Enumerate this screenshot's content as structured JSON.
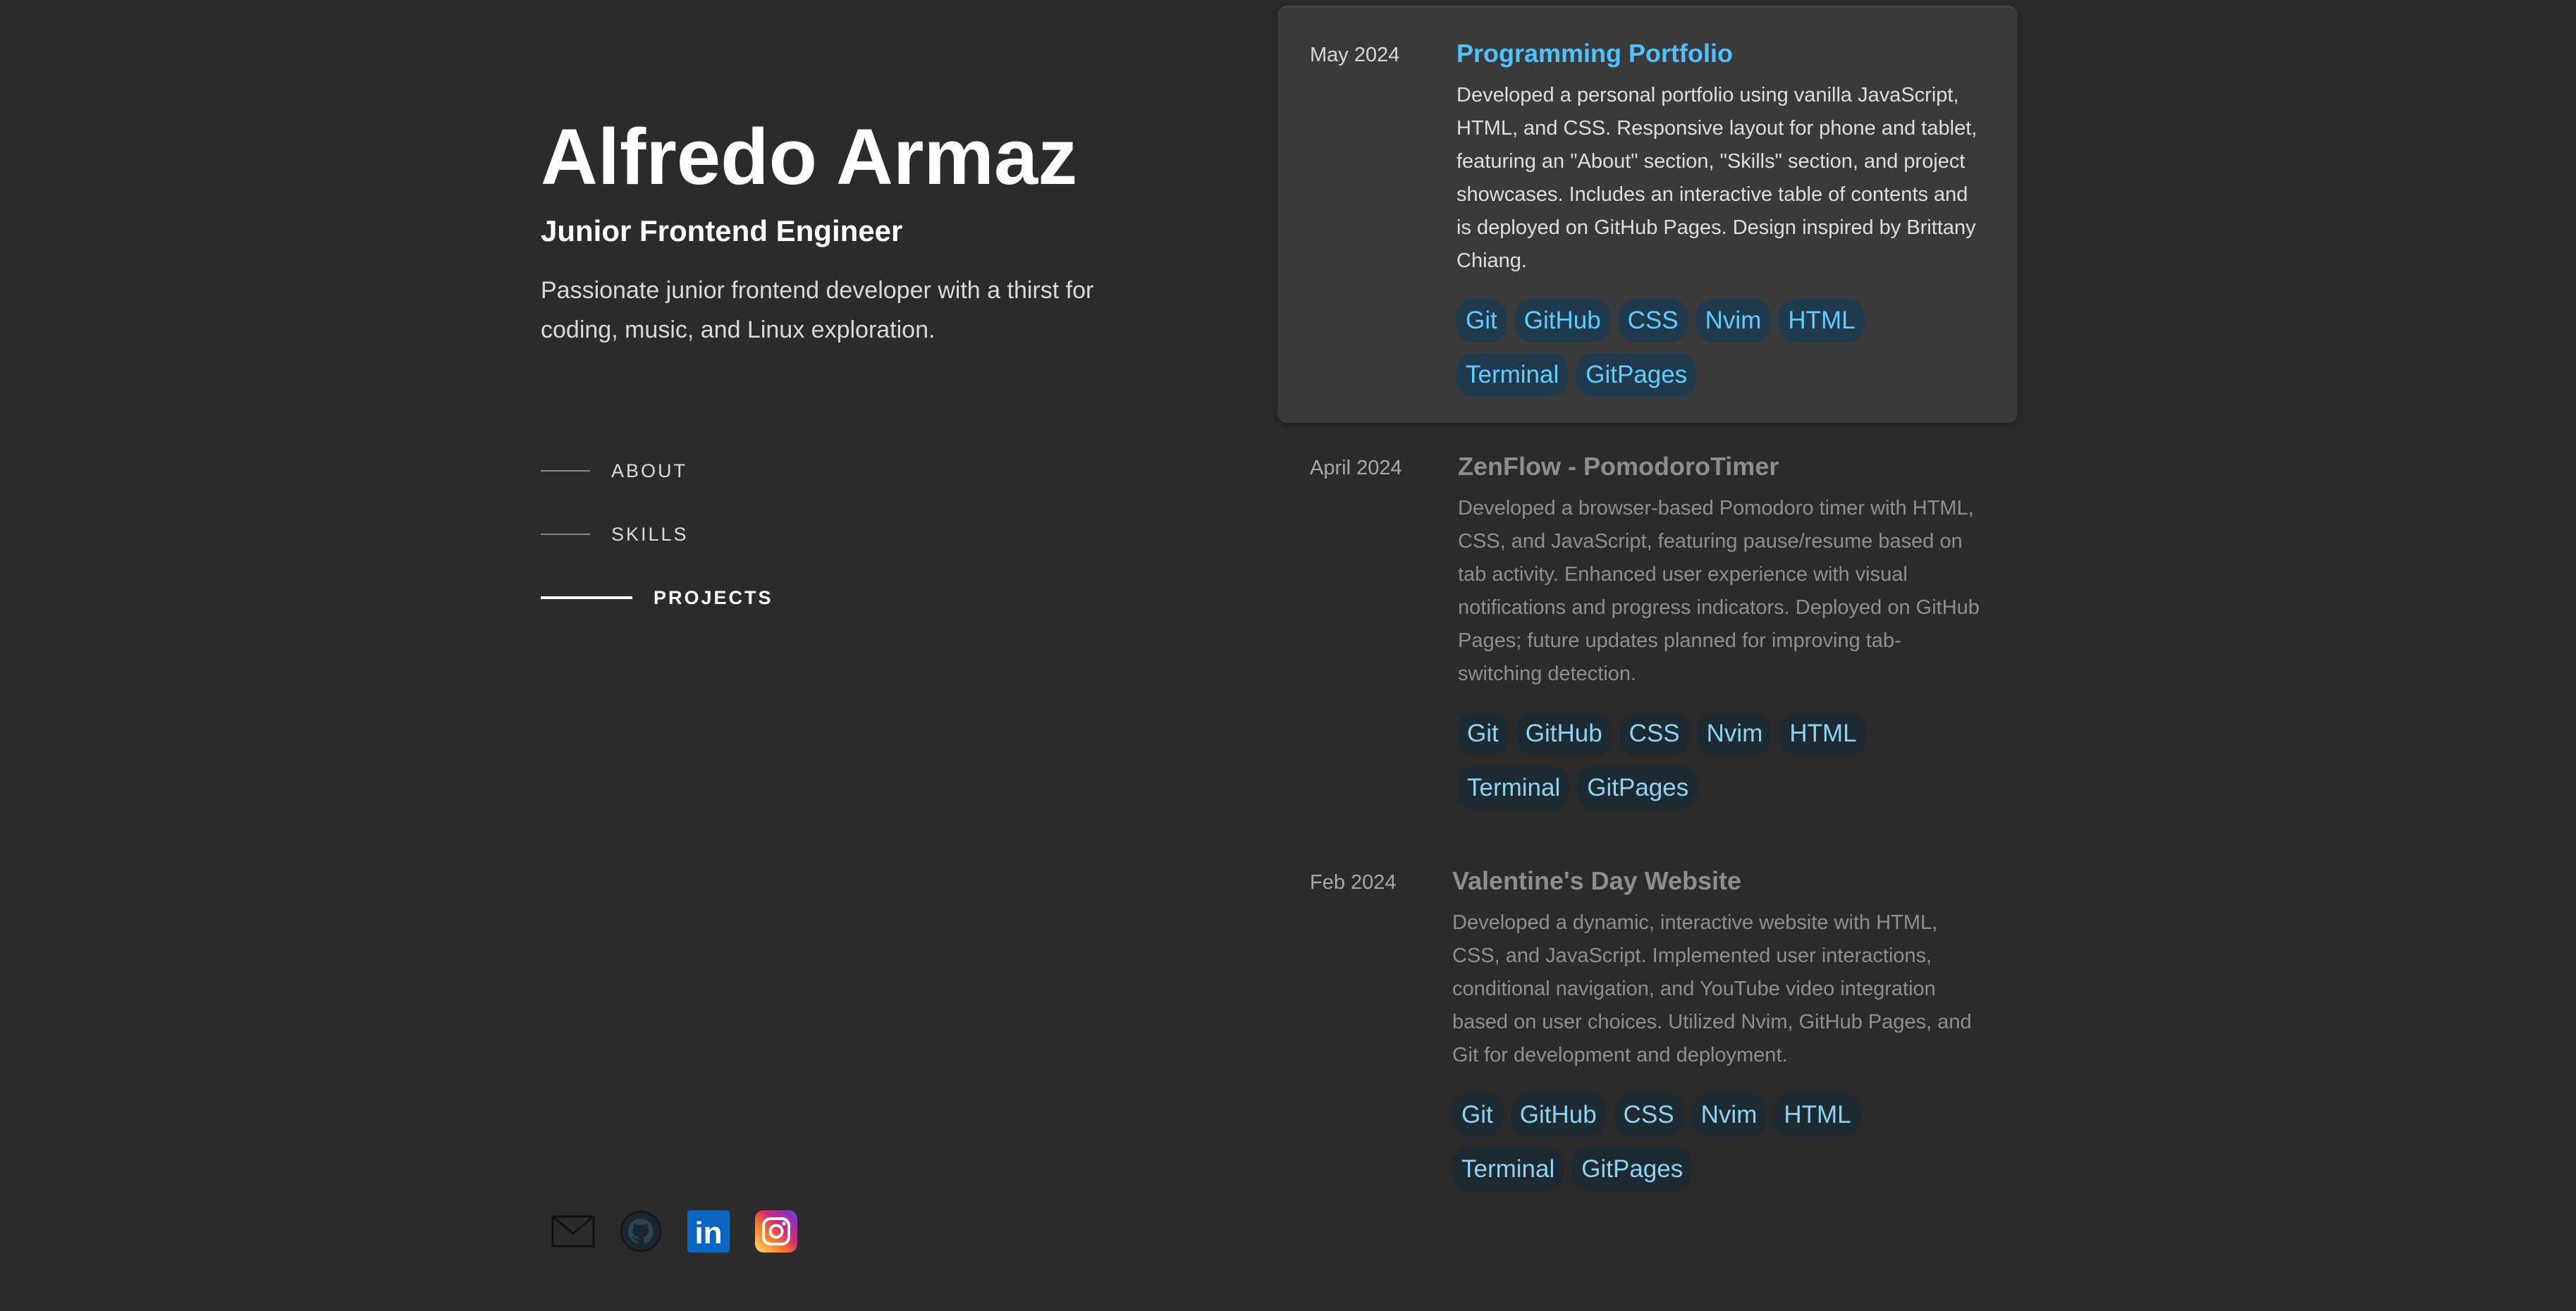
{
  "profile": {
    "name": "Alfredo Armaz",
    "role": "Junior Frontend Engineer",
    "bio": "Passionate junior frontend developer with a thirst for coding, music, and Linux exploration."
  },
  "nav": {
    "items": [
      {
        "label": "ABOUT",
        "active": false
      },
      {
        "label": "SKILLS",
        "active": false
      },
      {
        "label": "PROJECTS",
        "active": true
      }
    ]
  },
  "socials": {
    "icons": [
      "mail-icon",
      "github-icon",
      "linkedin-icon",
      "instagram-icon"
    ],
    "linkedin_text": "in"
  },
  "projects": [
    {
      "date": "May 2024",
      "title": "Programming Portfolio",
      "description": "Developed a personal portfolio using vanilla JavaScript, HTML, and CSS. Responsive layout for phone and tablet, featuring an \"About\" section, \"Skills\" section, and project showcases. Includes an interactive table of contents and is deployed on GitHub Pages. Design inspired by Brittany Chiang.",
      "tags": [
        "Git",
        "GitHub",
        "CSS",
        "Nvim",
        "HTML",
        "Terminal",
        "GitPages"
      ]
    },
    {
      "date": "April 2024",
      "title": "ZenFlow - PomodoroTimer",
      "description": "Developed a browser-based Pomodoro timer with HTML, CSS, and JavaScript, featuring pause/resume based on tab activity. Enhanced user experience with visual notifications and progress indicators. Deployed on GitHub Pages; future updates planned for improving tab-switching detection.",
      "tags": [
        "Git",
        "GitHub",
        "CSS",
        "Nvim",
        "HTML",
        "Terminal",
        "GitPages"
      ]
    },
    {
      "date": "Feb 2024",
      "title": "Valentine's Day Website",
      "description": "Developed a dynamic, interactive website with HTML, CSS, and JavaScript. Implemented user interactions, conditional navigation, and YouTube video integration based on user choices. Utilized Nvim, GitHub Pages, and Git for development and deployment.",
      "tags": [
        "Git",
        "GitHub",
        "CSS",
        "Nvim",
        "HTML",
        "Terminal",
        "GitPages"
      ]
    }
  ],
  "colors": {
    "background": "#2b2b2b",
    "accent": "#4cc3ff",
    "tag_bg": "#1f3a4c",
    "highlight_card": "#3a3a3a"
  }
}
